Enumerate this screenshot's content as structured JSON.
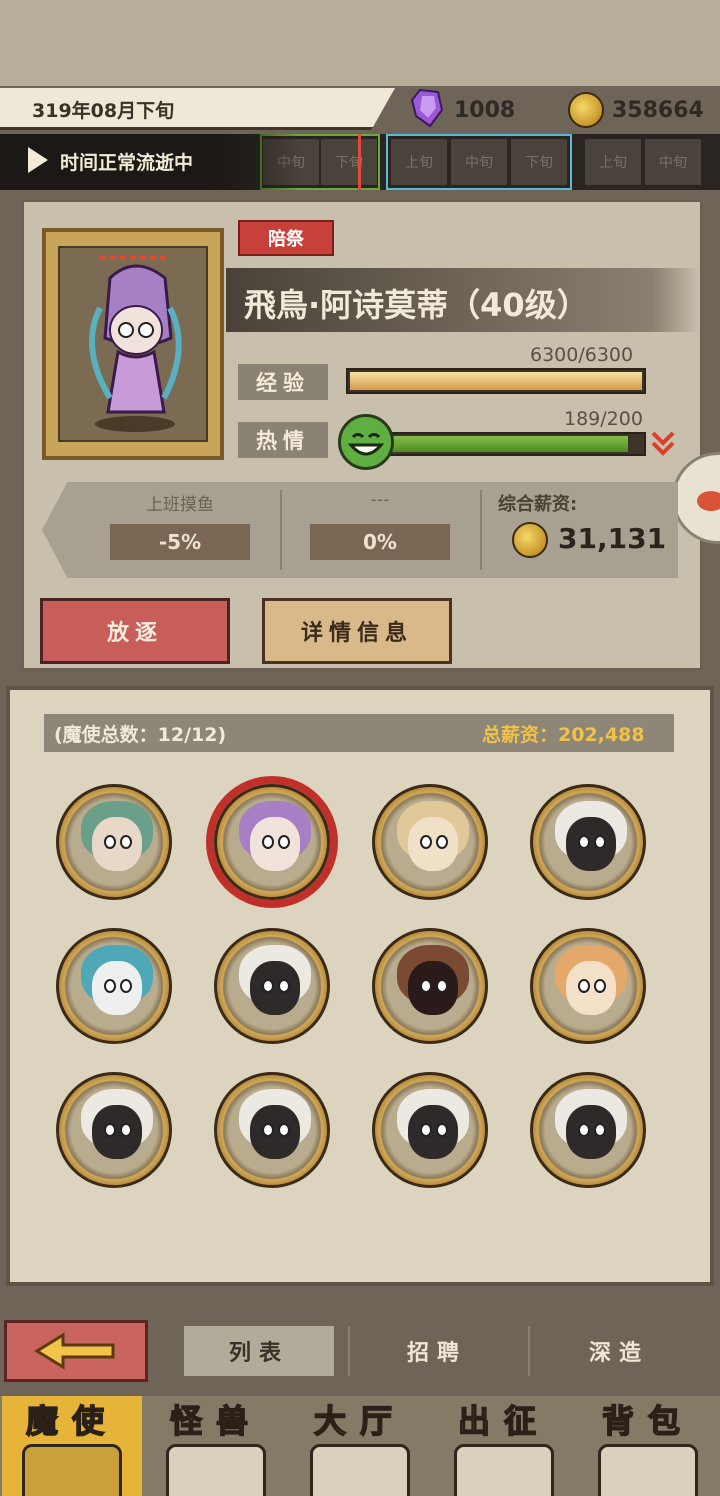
{
  "header": {
    "date": "319年08月下旬",
    "gems": "1008",
    "gold": "358664"
  },
  "timeline": {
    "status": "时间正常流逝中",
    "cells": [
      "中旬",
      "下旬",
      "上旬",
      "中旬",
      "下旬",
      "上旬",
      "中旬"
    ]
  },
  "character": {
    "tag": "陪祭",
    "name": "飛鳥·阿诗莫蒂（40级）",
    "exp_label": "经验",
    "exp_value": "6300/6300",
    "exp_fraction": 1.0,
    "passion_label": "热情",
    "passion_value": "189/200",
    "passion_fraction": 0.945
  },
  "stats": {
    "stat1_label": "上班摸鱼",
    "stat1_value": "-5%",
    "stat2_label": "---",
    "stat2_value": "0%",
    "salary_label": "综合薪资:",
    "salary_value": "31,131"
  },
  "actions": {
    "exile": "放逐",
    "details": "详情信息"
  },
  "roster": {
    "count_label": "(魔使总数：12/12)",
    "total_salary": "总薪资：202,488",
    "members": [
      {
        "name": "avatar-1",
        "face": "#e8d8c8",
        "hair": "#6aa08a"
      },
      {
        "name": "avatar-2",
        "face": "#f1e2dc",
        "hair": "#a77fc4",
        "selected": true
      },
      {
        "name": "avatar-3",
        "face": "#f1e0c8",
        "hair": "#e0c89a"
      },
      {
        "name": "avatar-4",
        "face": "#2e2a2a",
        "hair": "#ece8e2"
      },
      {
        "name": "avatar-5",
        "face": "#eef0f0",
        "hair": "#4fa8b8"
      },
      {
        "name": "avatar-6",
        "face": "#2e2a2a",
        "hair": "#ece8e2"
      },
      {
        "name": "avatar-7",
        "face": "#2a1a1a",
        "hair": "#7a4a32"
      },
      {
        "name": "avatar-8",
        "face": "#f3e0c8",
        "hair": "#e3a86a"
      },
      {
        "name": "avatar-9",
        "face": "#2e2a2a",
        "hair": "#ece8e2"
      },
      {
        "name": "avatar-10",
        "face": "#2e2a2a",
        "hair": "#ece8e2"
      },
      {
        "name": "avatar-11",
        "face": "#2e2a2a",
        "hair": "#ece8e2"
      },
      {
        "name": "avatar-12",
        "face": "#2e2a2a",
        "hair": "#ece8e2"
      }
    ]
  },
  "tabs": {
    "list": "列表",
    "recruit": "招聘",
    "deep": "深造"
  },
  "nav": {
    "items": [
      "魔使",
      "怪兽",
      "大厅",
      "出征",
      "背包"
    ]
  },
  "colors": {
    "accent_red": "#c8403a",
    "gold": "#f0c24a",
    "exp_fill": "#e7b86a",
    "passion_fill": "#6aa838"
  }
}
